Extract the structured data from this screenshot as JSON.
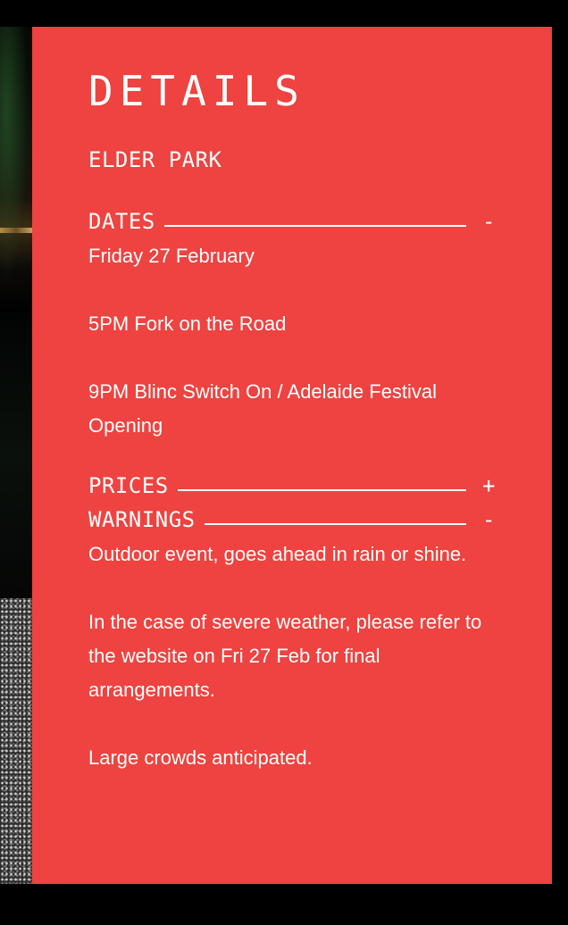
{
  "details": {
    "heading": "DETAILS",
    "venue": "ELDER PARK"
  },
  "sections": {
    "dates": {
      "label": "DATES",
      "toggle": "-",
      "lines": [
        "Friday 27 February",
        "5PM Fork on the Road",
        "9PM Blinc Switch On / Adelaide Festival Opening"
      ]
    },
    "prices": {
      "label": "PRICES",
      "toggle": "+"
    },
    "warnings": {
      "label": "WARNINGS",
      "toggle": "-",
      "lines": [
        "Outdoor event, goes ahead in rain or shine.",
        "In the case of severe weather, please refer to the website on Fri 27 Feb for final arrangements.",
        "Large crowds anticipated."
      ]
    }
  },
  "colors": {
    "panel": "#ee4340",
    "text": "#ffffff",
    "page_background": "#000000"
  }
}
